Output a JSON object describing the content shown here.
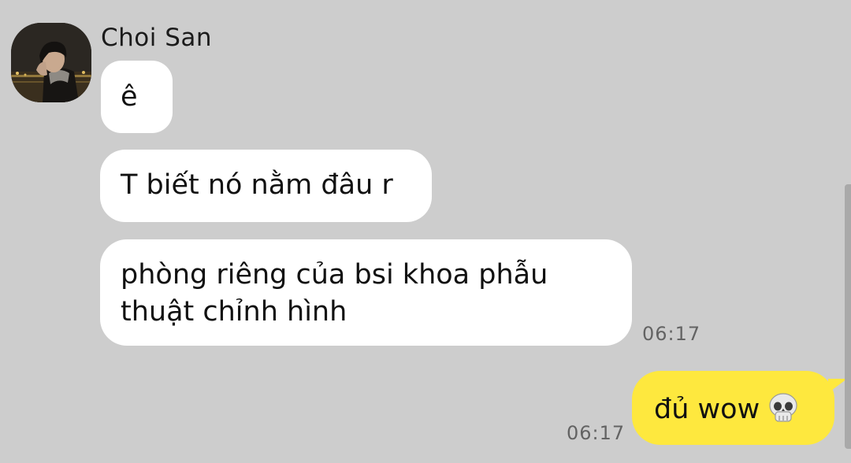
{
  "chat": {
    "sender_name": "Choi San",
    "avatar_icon": "profile-photo",
    "incoming": [
      "ê",
      "T biết nó nằm đâu r",
      "phòng riêng của bsi khoa phẫu thuật chỉnh hình"
    ],
    "incoming_time": "06:17",
    "outgoing_text": "đủ wow",
    "outgoing_emoji_icon": "skull-icon",
    "outgoing_time": "06:17"
  },
  "colors": {
    "background": "#cdcdcd",
    "incoming_bubble": "#ffffff",
    "outgoing_bubble": "#fee83e",
    "timestamp": "#636363"
  }
}
